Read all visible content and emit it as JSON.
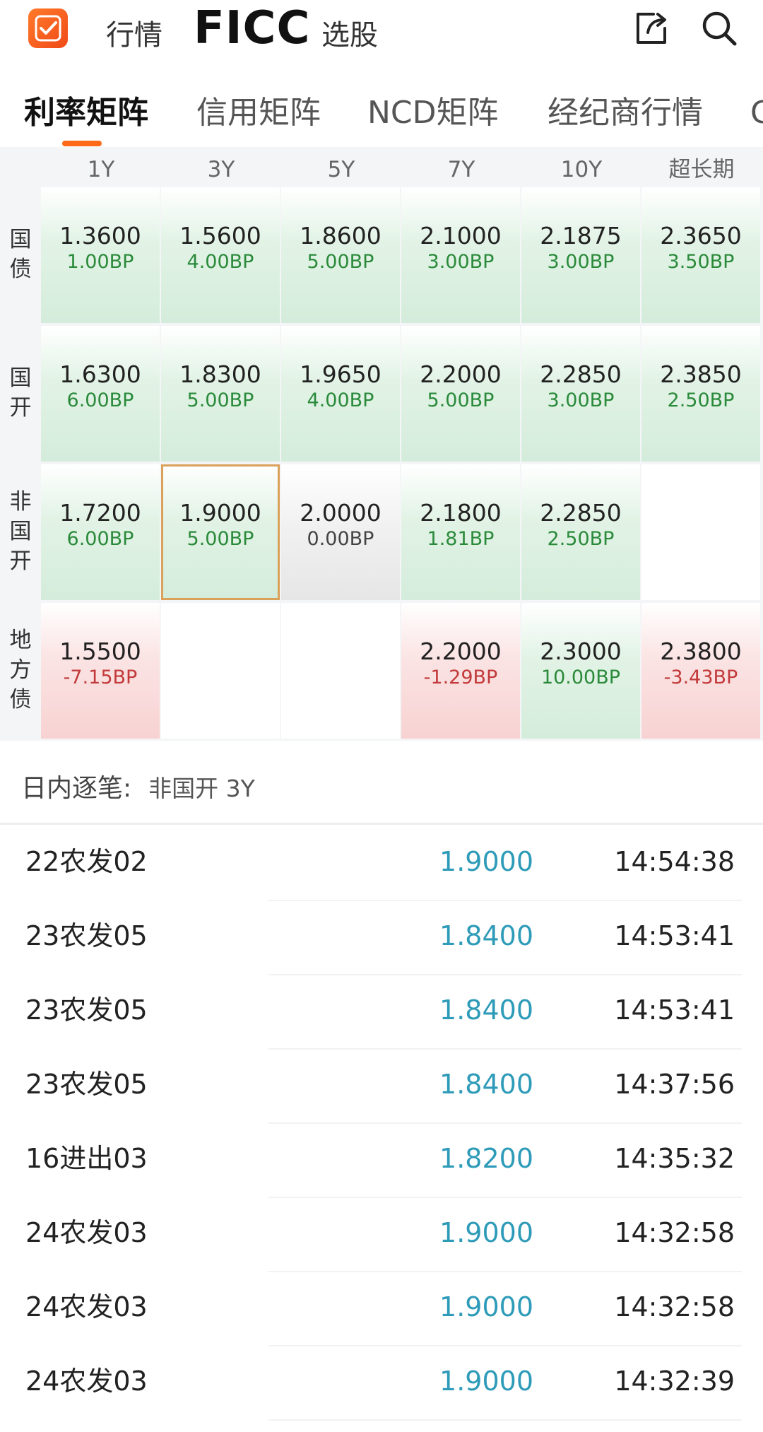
{
  "header": {
    "nav": [
      "行情",
      "FICC",
      "选股"
    ],
    "icons": {
      "logo": "check-logo-icon",
      "share": "share-icon",
      "search": "search-icon"
    },
    "accent": "#ff6a1a"
  },
  "tabs": [
    "利率矩阵",
    "信用矩阵",
    "NCD矩阵",
    "经纪商行情",
    "C"
  ],
  "active_tab": "利率矩阵",
  "matrix": {
    "columns": [
      "1Y",
      "3Y",
      "5Y",
      "7Y",
      "10Y",
      "超长期"
    ],
    "rows": [
      {
        "label": "国债",
        "cells": [
          {
            "yield": "1.3600",
            "bp": "1.00BP",
            "trend": "up"
          },
          {
            "yield": "1.5600",
            "bp": "4.00BP",
            "trend": "up"
          },
          {
            "yield": "1.8600",
            "bp": "5.00BP",
            "trend": "up"
          },
          {
            "yield": "2.1000",
            "bp": "3.00BP",
            "trend": "up"
          },
          {
            "yield": "2.1875",
            "bp": "3.00BP",
            "trend": "up"
          },
          {
            "yield": "2.3650",
            "bp": "3.50BP",
            "trend": "up"
          }
        ]
      },
      {
        "label": "国开",
        "cells": [
          {
            "yield": "1.6300",
            "bp": "6.00BP",
            "trend": "up"
          },
          {
            "yield": "1.8300",
            "bp": "5.00BP",
            "trend": "up"
          },
          {
            "yield": "1.9650",
            "bp": "4.00BP",
            "trend": "up"
          },
          {
            "yield": "2.2000",
            "bp": "5.00BP",
            "trend": "up"
          },
          {
            "yield": "2.2850",
            "bp": "3.00BP",
            "trend": "up"
          },
          {
            "yield": "2.3850",
            "bp": "2.50BP",
            "trend": "up"
          }
        ]
      },
      {
        "label": "非国开",
        "cells": [
          {
            "yield": "1.7200",
            "bp": "6.00BP",
            "trend": "up"
          },
          {
            "yield": "1.9000",
            "bp": "5.00BP",
            "trend": "up",
            "selected": true
          },
          {
            "yield": "2.0000",
            "bp": "0.00BP",
            "trend": "flat"
          },
          {
            "yield": "2.1800",
            "bp": "1.81BP",
            "trend": "up"
          },
          {
            "yield": "2.2850",
            "bp": "2.50BP",
            "trend": "up"
          },
          {
            "yield": "",
            "bp": "",
            "trend": "empty"
          }
        ]
      },
      {
        "label": "地方债",
        "cells": [
          {
            "yield": "1.5500",
            "bp": "-7.15BP",
            "trend": "down"
          },
          {
            "yield": "",
            "bp": "",
            "trend": "empty"
          },
          {
            "yield": "",
            "bp": "",
            "trend": "empty"
          },
          {
            "yield": "2.2000",
            "bp": "-1.29BP",
            "trend": "down"
          },
          {
            "yield": "2.3000",
            "bp": "10.00BP",
            "trend": "up"
          },
          {
            "yield": "2.3800",
            "bp": "-3.43BP",
            "trend": "down"
          }
        ]
      }
    ],
    "colors": {
      "up": "#2a8a3a",
      "down": "#c23a3a",
      "selected_border": "#d9a15a"
    }
  },
  "intraday": {
    "title": "日内逐笔:",
    "selection": "非国开 3Y",
    "trades": [
      {
        "name": "22农发02",
        "price": "1.9000",
        "time": "14:54:38"
      },
      {
        "name": "23农发05",
        "price": "1.8400",
        "time": "14:53:41"
      },
      {
        "name": "23农发05",
        "price": "1.8400",
        "time": "14:53:41"
      },
      {
        "name": "23农发05",
        "price": "1.8400",
        "time": "14:37:56"
      },
      {
        "name": "16进出03",
        "price": "1.8200",
        "time": "14:35:32"
      },
      {
        "name": "24农发03",
        "price": "1.9000",
        "time": "14:32:58"
      },
      {
        "name": "24农发03",
        "price": "1.9000",
        "time": "14:32:58"
      },
      {
        "name": "24农发03",
        "price": "1.9000",
        "time": "14:32:39"
      }
    ],
    "price_color": "#2e9bb8"
  }
}
